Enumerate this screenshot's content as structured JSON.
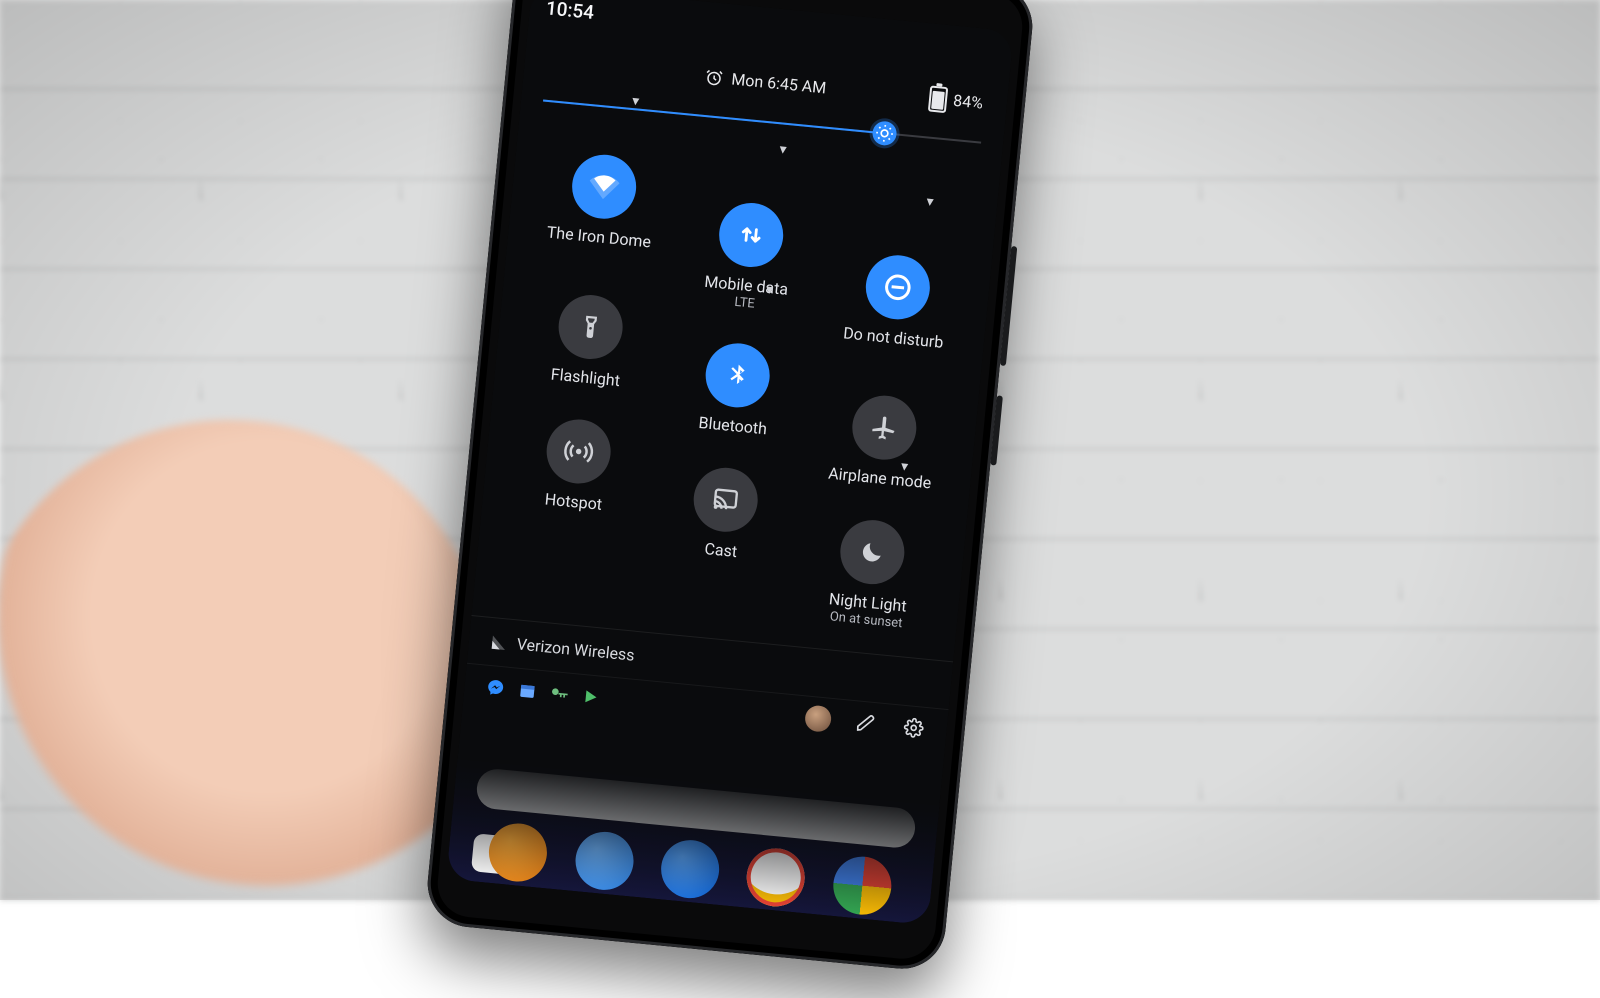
{
  "status": {
    "time": "10:54"
  },
  "qs_header": {
    "alarm_text": "Mon 6:45 AM",
    "battery_text": "84%"
  },
  "brightness": {
    "percent": 78
  },
  "tiles": [
    {
      "id": "wifi",
      "label": "The Iron Dome",
      "sub": "",
      "active": true,
      "icon": "wifi",
      "expandable": true
    },
    {
      "id": "mobiledata",
      "label": "Mobile data",
      "sub": "LTE",
      "active": true,
      "icon": "data",
      "expandable": true
    },
    {
      "id": "dnd",
      "label": "Do not disturb",
      "sub": "",
      "active": true,
      "icon": "dnd",
      "expandable": true
    },
    {
      "id": "flashlight",
      "label": "Flashlight",
      "sub": "",
      "active": false,
      "icon": "flashlight",
      "expandable": false
    },
    {
      "id": "bluetooth",
      "label": "Bluetooth",
      "sub": "",
      "active": true,
      "icon": "bluetooth",
      "expandable": true
    },
    {
      "id": "airplane",
      "label": "Airplane mode",
      "sub": "",
      "active": false,
      "icon": "airplane",
      "expandable": false
    },
    {
      "id": "hotspot",
      "label": "Hotspot",
      "sub": "",
      "active": false,
      "icon": "hotspot",
      "expandable": false
    },
    {
      "id": "cast",
      "label": "Cast",
      "sub": "",
      "active": false,
      "icon": "cast",
      "expandable": false
    },
    {
      "id": "nightlight",
      "label": "Night Light",
      "sub": "On at sunset",
      "active": false,
      "icon": "moon",
      "expandable": true
    }
  ],
  "carrier": {
    "name": "Verizon Wireless"
  },
  "footer_icons": [
    "messenger",
    "calendar",
    "vpn-key",
    "play"
  ],
  "colors": {
    "accent": "#2f8dff",
    "tile_off": "#3a3b40"
  }
}
